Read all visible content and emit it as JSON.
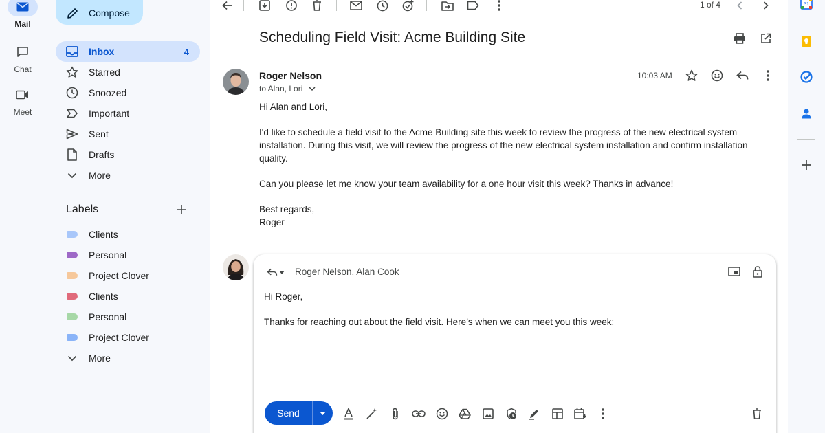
{
  "rail": {
    "mail_label": "Mail",
    "chat_label": "Chat",
    "meet_label": "Meet"
  },
  "nav": {
    "compose_label": "Compose",
    "items": [
      {
        "label": "Inbox",
        "count": "4"
      },
      {
        "label": "Starred"
      },
      {
        "label": "Snoozed"
      },
      {
        "label": "Important"
      },
      {
        "label": "Sent"
      },
      {
        "label": "Drafts"
      },
      {
        "label": "More"
      }
    ],
    "labels_heading": "Labels",
    "labels": [
      {
        "label": "Clients",
        "color": "#a8c7fa"
      },
      {
        "label": "Personal",
        "color": "#9e69c7"
      },
      {
        "label": "Project Clover",
        "color": "#f6c89b"
      },
      {
        "label": "Clients",
        "color": "#e06a7b"
      },
      {
        "label": "Personal",
        "color": "#a7d8a7"
      },
      {
        "label": "Project Clover",
        "color": "#8ab4f8"
      }
    ],
    "labels_more": "More"
  },
  "toolbar": {
    "pager": "1 of 4"
  },
  "message": {
    "subject": "Scheduling Field Visit: Acme Building Site",
    "sender": "Roger Nelson",
    "to": "to Alan, Lori",
    "time": "10:03 AM",
    "body": [
      "Hi Alan and Lori,",
      "I'd like to schedule a field visit to the Acme Building site this week to review the progress of the new electrical system installation. During this visit, we will review the progress of the new electrical system installation and confirm installation quality.",
      "Can you please let me know your team availability for a one hour visit this week? Thanks in advance!"
    ],
    "signoff": "Best regards,",
    "signature": "Roger"
  },
  "reply": {
    "recipients": "Roger Nelson, Alan Cook",
    "greeting": "Hi Roger,",
    "text": "Thanks for reaching out about the field visit. Here’s when we can meet you this week:",
    "send_label": "Send"
  },
  "colors": {
    "accent": "#0b57d0",
    "selected": "#d3e3fd",
    "compose": "#c2e7ff"
  }
}
